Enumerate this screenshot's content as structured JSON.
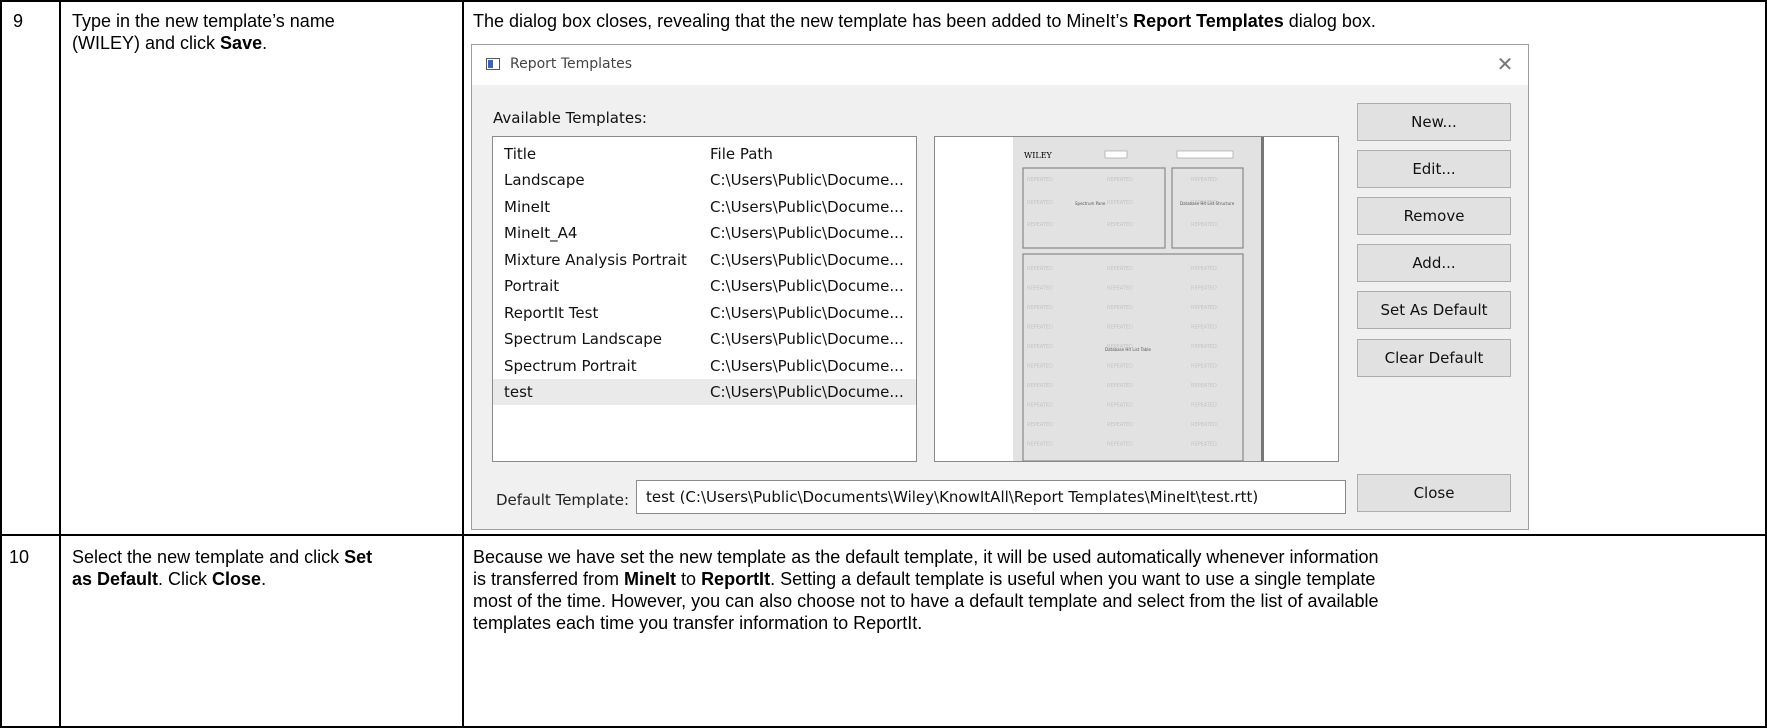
{
  "rows": [
    {
      "step": "9",
      "instruction": {
        "line1": "Type in the new template’s name",
        "line2_prefix": "(WILEY) and click ",
        "line2_bold": "Save",
        "line2_suffix": "."
      },
      "result": {
        "prefix": "The dialog box closes, revealing that the new template has been added to MineIt’s ",
        "bold": "Report Templates",
        "suffix": " dialog box."
      }
    },
    {
      "step": "10",
      "instruction": {
        "line1_prefix": "Select the new template and click ",
        "line1_bold": "Set",
        "line2_bold": "as Default",
        "line2_mid": ". Click ",
        "line2_bold2": "Close",
        "line2_suffix": "."
      },
      "result": {
        "l1": "Because we have set the new template as the default template, it will be used automatically whenever information",
        "l2_a": "is transferred from ",
        "l2_b1": "MineIt",
        "l2_c": " to ",
        "l2_b2": "ReportIt",
        "l2_d": ". Setting a default template is useful when you want to use a single template",
        "l3": "most of the time. However, you can also choose not to have a default template and select from the list of available",
        "l4": "templates each time you transfer information to ReportIt."
      }
    }
  ],
  "dialog": {
    "title": "Report Templates",
    "close_glyph": "✕",
    "available_label": "Available Templates:",
    "columns": [
      "Title",
      "File Path"
    ],
    "templates": [
      {
        "title": "Landscape",
        "path": "C:\\Users\\Public\\Docume..."
      },
      {
        "title": "MineIt",
        "path": "C:\\Users\\Public\\Docume..."
      },
      {
        "title": "MineIt_A4",
        "path": "C:\\Users\\Public\\Docume..."
      },
      {
        "title": "Mixture Analysis Portrait",
        "path": "C:\\Users\\Public\\Docume..."
      },
      {
        "title": "Portrait",
        "path": "C:\\Users\\Public\\Docume..."
      },
      {
        "title": "ReportIt Test",
        "path": "C:\\Users\\Public\\Docume..."
      },
      {
        "title": "Spectrum Landscape",
        "path": "C:\\Users\\Public\\Docume..."
      },
      {
        "title": "Spectrum Portrait",
        "path": "C:\\Users\\Public\\Docume..."
      },
      {
        "title": "test",
        "path": "C:\\Users\\Public\\Docume...",
        "selected": true
      }
    ],
    "buttons": {
      "new": "New...",
      "edit": "Edit...",
      "remove": "Remove",
      "add": "Add...",
      "set_default": "Set As Default",
      "clear_default": "Clear Default",
      "close": "Close"
    },
    "default_label": "Default Template:",
    "default_value": "test (C:\\Users\\Public\\Documents\\Wiley\\KnowItAll\\Report Templates\\MineIt\\test.rtt)",
    "preview": {
      "logo": "WILEY",
      "repeated": "REPEATED",
      "spectrum_label": "Spectrum Pane",
      "db_label": "Database Hit List Structure",
      "table_label": "Database Hit List Table"
    }
  }
}
